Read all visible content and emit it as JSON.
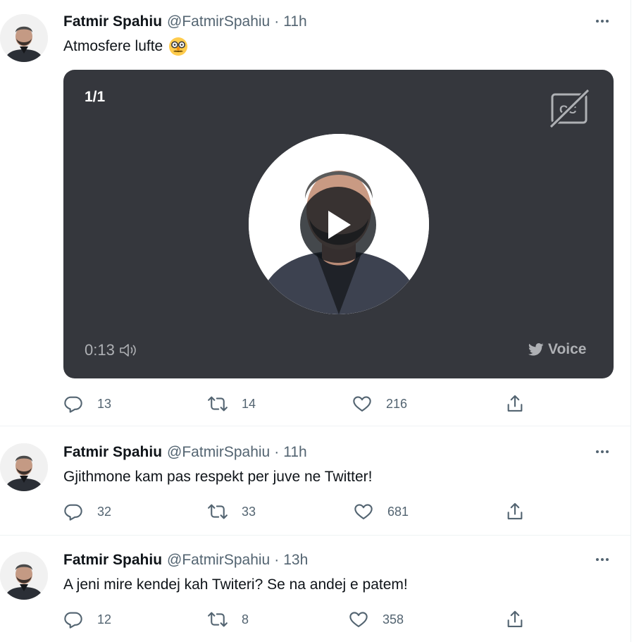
{
  "tweets": [
    {
      "author": "Fatmir Spahiu",
      "handle": "@FatmirSpahiu",
      "separator": "·",
      "time": "11h",
      "text": "Atmosfere lufte",
      "emoji": "disguised-face-emoji",
      "media": {
        "counter": "1/1",
        "duration": "0:13",
        "voice_label": "Voice",
        "background": "#35373d",
        "icons": [
          "closed-captions-off-icon",
          "volume-icon",
          "twitter-bird-icon",
          "play-icon"
        ]
      },
      "actions": {
        "replies": "13",
        "retweets": "14",
        "likes": "216"
      }
    },
    {
      "author": "Fatmir Spahiu",
      "handle": "@FatmirSpahiu",
      "separator": "·",
      "time": "11h",
      "text": "Gjithmone kam pas respekt per juve ne Twitter!",
      "actions": {
        "replies": "32",
        "retweets": "33",
        "likes": "681"
      }
    },
    {
      "author": "Fatmir Spahiu",
      "handle": "@FatmirSpahiu",
      "separator": "·",
      "time": "13h",
      "text": "A jeni mire kendej kah Twiteri? Se na andej e patem!",
      "actions": {
        "replies": "12",
        "retweets": "8",
        "likes": "358"
      }
    }
  ],
  "colors": {
    "primary_text": "#0f1419",
    "secondary_text": "#536471",
    "divider": "#eff3f4",
    "media_background": "#35373d"
  },
  "icons": [
    "reply-icon",
    "retweet-icon",
    "like-icon",
    "share-icon",
    "more-icon"
  ]
}
